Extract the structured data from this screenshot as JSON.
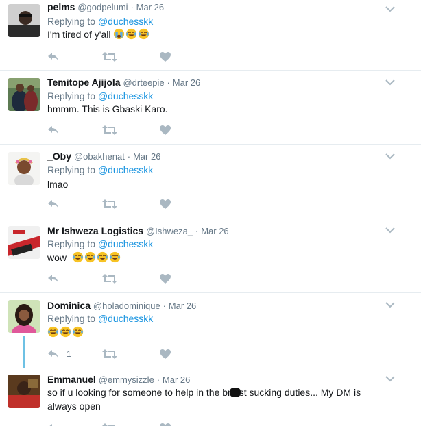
{
  "tweets": [
    {
      "name": "pelms",
      "handle": "@godpelumi",
      "dot": "·",
      "time": "Mar 26",
      "replying_prefix": "Replying to",
      "replying_to": "@duchesskk",
      "text": "I'm tired of y'all",
      "emojis": [
        "loudly-crying-face",
        "tears-of-joy-face",
        "tears-of-joy-face"
      ],
      "reply_count": "",
      "avatar": "user-avatar-pelms"
    },
    {
      "name": "Temitope Ajijola",
      "handle": "@drteepie",
      "dot": "·",
      "time": "Mar 26",
      "replying_prefix": "Replying to",
      "replying_to": "@duchesskk",
      "text": "hmmm. This is Gbaski Karo.",
      "emojis": [],
      "reply_count": "",
      "avatar": "user-avatar-temitope"
    },
    {
      "name": "_Oby",
      "handle": "@obakhenat",
      "dot": "·",
      "time": "Mar 26",
      "replying_prefix": "Replying to",
      "replying_to": "@duchesskk",
      "text": "lmao",
      "emojis": [],
      "reply_count": "",
      "avatar": "user-avatar-oby"
    },
    {
      "name": "Mr Ishweza Logistics",
      "handle": "@Ishweza_",
      "dot": "·",
      "time": "Mar 26",
      "replying_prefix": "Replying to",
      "replying_to": "@duchesskk",
      "text": "wow ",
      "emojis": [
        "tears-of-joy-face",
        "tears-of-joy-face",
        "tears-of-joy-face",
        "tears-of-joy-face"
      ],
      "reply_count": "",
      "avatar": "user-avatar-ishweza"
    },
    {
      "name": "Dominica",
      "handle": "@holadominique",
      "dot": "·",
      "time": "Mar 26",
      "replying_prefix": "Replying to",
      "replying_to": "@duchesskk",
      "text": "",
      "emojis": [
        "tears-of-joy-face",
        "tears-of-joy-face",
        "tears-of-joy-face"
      ],
      "reply_count": "1",
      "avatar": "user-avatar-dominica"
    },
    {
      "name": "Emmanuel",
      "handle": "@emmysizzle",
      "dot": "·",
      "time": "Mar 26",
      "text_part1": "so if u looking for someone to help in the br",
      "text_part2": "st sucking duties... My DM is",
      "text_line2": "always open",
      "reply_count": "",
      "avatar": "user-avatar-emmanuel"
    }
  ],
  "icons": {
    "reply": "reply-icon",
    "retweet": "retweet-icon",
    "like": "heart-icon",
    "menu": "chevron-down-icon"
  },
  "colors": {
    "link": "#1b95e0",
    "muted": "#657786",
    "icon": "#aab8c2",
    "thread": "#6ec1e4"
  }
}
